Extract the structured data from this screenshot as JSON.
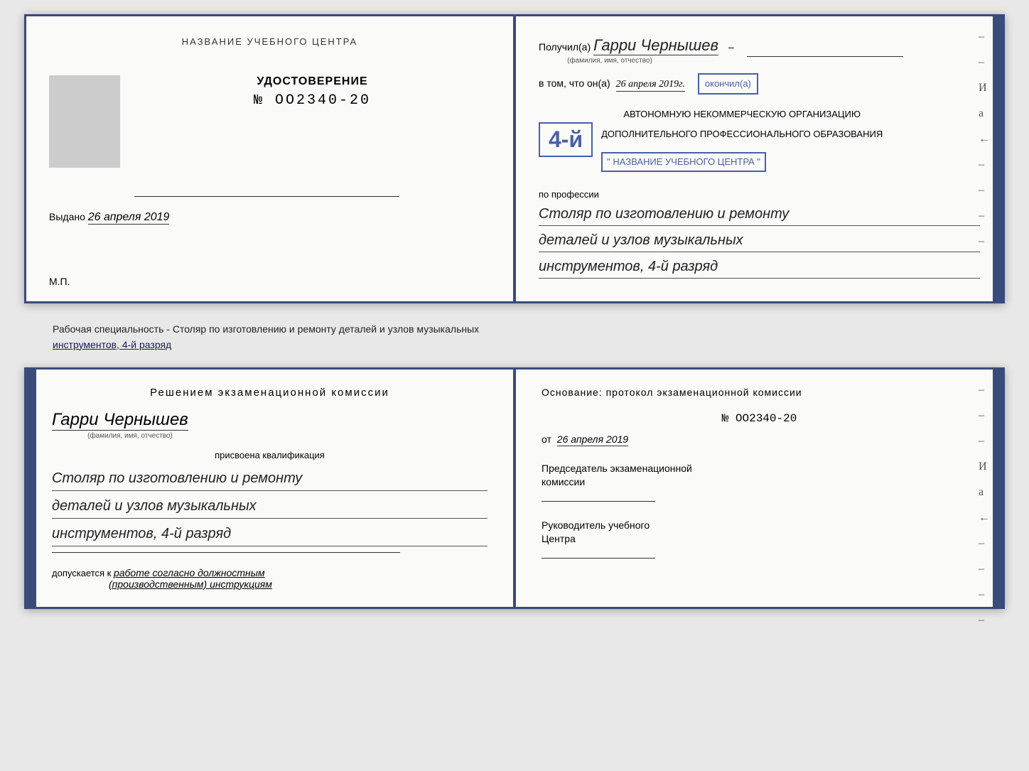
{
  "top_spread": {
    "left_page": {
      "title": "НАЗВАНИЕ УЧЕБНОГО ЦЕНТРА",
      "cert_label": "УДОСТОВЕРЕНИЕ",
      "cert_number": "№ OO2340-20",
      "issued_prefix": "Выдано",
      "issued_date": "26 апреля 2019",
      "mp": "М.П."
    },
    "right_page": {
      "recipient_prefix": "Получил(а)",
      "recipient_name": "Гарри Чернышев",
      "recipient_subtitle": "(фамилия, имя, отчество)",
      "vtom_prefix": "в том, что он(а)",
      "vtom_date": "26 апреля 2019г.",
      "okончил": "окончил(а)",
      "level": "4-й",
      "org_line1": "АВТОНОМНУЮ НЕКОММЕРЧЕСКУЮ ОРГАНИЗАЦИЮ",
      "org_line2": "ДОПОЛНИТЕЛЬНОГО ПРОФЕССИОНАЛЬНОГО ОБРАЗОВАНИЯ",
      "org_name": "\" НАЗВАНИЕ УЧЕБНОГО ЦЕНТРА \"",
      "profession_label": "по профессии",
      "profession_line1": "Столяр по изготовлению и ремонту",
      "profession_line2": "деталей и узлов музыкальных",
      "profession_line3": "инструментов, 4-й разряд"
    }
  },
  "specialty_label": "Рабочая специальность - Столяр по изготовлению и ремонту деталей и узлов музыкальных",
  "specialty_label2": "инструментов, 4-й разряд",
  "bottom_spread": {
    "left_page": {
      "decision_title": "Решением  экзаменационной  комиссии",
      "person_name": "Гарри Чернышев",
      "person_subtitle": "(фамилия, имя, отчество)",
      "qualification_label": "присвоена квалификация",
      "qual_line1": "Столяр по изготовлению и ремонту",
      "qual_line2": "деталей и узлов музыкальных",
      "qual_line3": "инструментов, 4-й разряд",
      "допускается_prefix": "допускается к",
      "допускается_text": "работе согласно должностным",
      "допускается_text2": "(производственным) инструкциям"
    },
    "right_page": {
      "basis_title": "Основание: протокол экзаменационной  комиссии",
      "number": "№  OO2340-20",
      "ot_prefix": "от",
      "ot_date": "26 апреля 2019",
      "chairman_label": "Председатель экзаменационной\nкомиссии",
      "director_label": "Руководитель учебного\nЦентра"
    }
  },
  "right_dashes": [
    "-",
    "-",
    "И",
    "а",
    "←",
    "-",
    "-",
    "-",
    "-"
  ]
}
